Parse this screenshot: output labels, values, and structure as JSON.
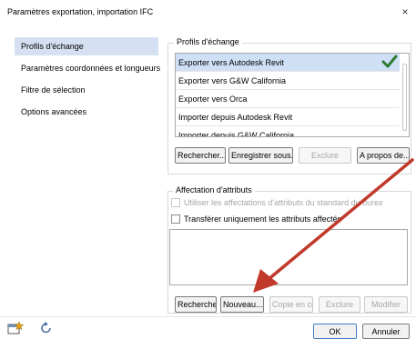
{
  "window": {
    "title": "Paramètres exportation, importation IFC",
    "close_glyph": "×"
  },
  "sidebar": {
    "items": [
      {
        "label": "Profils d'échange",
        "active": true
      },
      {
        "label": "Paramètres coordonnées et longueurs",
        "active": false
      },
      {
        "label": "Filtre de sélection",
        "active": false
      },
      {
        "label": "Options avancées",
        "active": false
      }
    ]
  },
  "profiles": {
    "group_title": "Profils d'échange",
    "items": [
      {
        "label": "Exporter vers Autodesk Revit",
        "selected": true
      },
      {
        "label": "Exporter vers G&W California",
        "selected": false
      },
      {
        "label": "Exporter vers Orca",
        "selected": false
      },
      {
        "label": "Importer depuis Autodesk Revit",
        "selected": false
      },
      {
        "label": "Importer depuis G&W California",
        "selected": false
      }
    ],
    "check_icon": "checkmark-icon",
    "buttons": {
      "search": "Rechercher...",
      "save_as": "Enregistrer sous...",
      "exclude": "Exclure",
      "about": "A propos de..."
    }
  },
  "attributes": {
    "group_title": "Affectation d'attributs",
    "use_standard_label": "Utiliser les affectations d'attributs du standard du bureau",
    "transfer_only_label": "Transférer uniquement les attributs affectés",
    "buttons": {
      "search": "Rechercher",
      "new": "Nouveau...",
      "copy": "Copie en cours",
      "exclude": "Exclure",
      "modify": "Modifier"
    }
  },
  "footer": {
    "ok": "OK",
    "cancel": "Annuler",
    "icons": [
      "favorites-icon",
      "reset-icon"
    ]
  },
  "colors": {
    "selection": "#d5e1f2",
    "arrow": "#c0392b",
    "check": "#2e7d32"
  }
}
